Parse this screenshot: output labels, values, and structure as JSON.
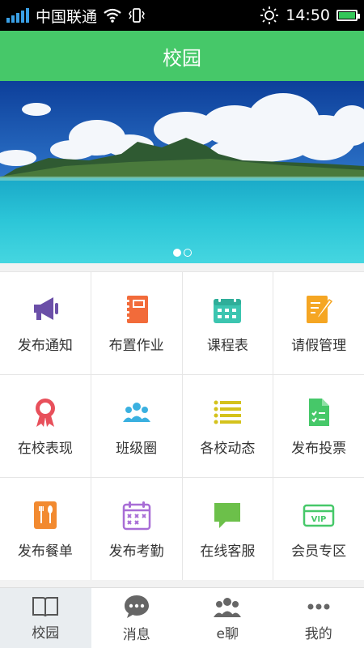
{
  "status_bar": {
    "carrier": "中国联通",
    "time": "14:50",
    "icons": [
      "signal-icon",
      "wifi-icon",
      "vibrate-icon",
      "brightness-icon",
      "battery-icon"
    ]
  },
  "header": {
    "title": "校园"
  },
  "banner": {
    "pages": 2,
    "current_page": 1
  },
  "grid": {
    "items": [
      {
        "label": "发布通知",
        "icon": "megaphone-icon",
        "color": "#6b4fa8"
      },
      {
        "label": "布置作业",
        "icon": "notebook-icon",
        "color": "#f26b3a"
      },
      {
        "label": "课程表",
        "icon": "calendar-icon",
        "color": "#3cc5b0"
      },
      {
        "label": "请假管理",
        "icon": "edit-document-icon",
        "color": "#f5a623"
      },
      {
        "label": "在校表现",
        "icon": "award-ribbon-icon",
        "color": "#e8505b"
      },
      {
        "label": "班级圈",
        "icon": "group-icon",
        "color": "#3ab0e0"
      },
      {
        "label": "各校动态",
        "icon": "list-icon",
        "color": "#d4c21c"
      },
      {
        "label": "发布投票",
        "icon": "vote-document-icon",
        "color": "#46c869"
      },
      {
        "label": "发布餐单",
        "icon": "menu-cutlery-icon",
        "color": "#f28a30"
      },
      {
        "label": "发布考勤",
        "icon": "attendance-calendar-icon",
        "color": "#a86dd6"
      },
      {
        "label": "在线客服",
        "icon": "chat-bubble-icon",
        "color": "#6cc04a"
      },
      {
        "label": "会员专区",
        "icon": "vip-card-icon",
        "color": "#46c869"
      }
    ]
  },
  "tabs": [
    {
      "label": "校园",
      "icon": "book-icon",
      "active": true
    },
    {
      "label": "消息",
      "icon": "message-icon",
      "active": false
    },
    {
      "label": "e聊",
      "icon": "contacts-icon",
      "active": false
    },
    {
      "label": "我的",
      "icon": "more-icon",
      "active": false
    }
  ]
}
